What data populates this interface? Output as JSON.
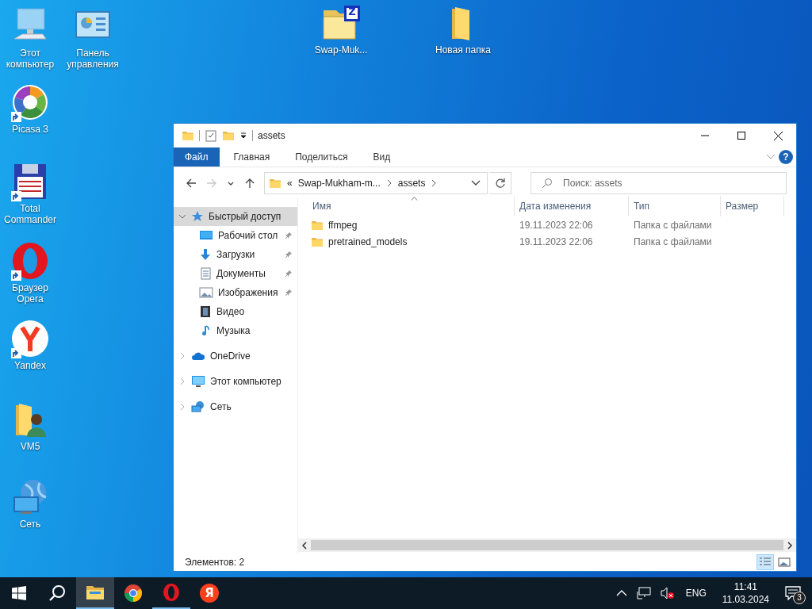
{
  "desktop_icons": [
    {
      "label": "Этот компьютер",
      "kind": "computer",
      "shortcut": false
    },
    {
      "label": "Панель управления",
      "kind": "control-panel",
      "shortcut": false
    },
    {
      "label": "Picasa 3",
      "kind": "picasa",
      "shortcut": true
    },
    {
      "label": "Total Commander",
      "kind": "total-commander",
      "shortcut": true
    },
    {
      "label": "Браузер Opera",
      "kind": "opera",
      "shortcut": true
    },
    {
      "label": "Yandex",
      "kind": "yandex",
      "shortcut": true
    },
    {
      "label": "VM5",
      "kind": "user-folder",
      "shortcut": false
    },
    {
      "label": "Сеть",
      "kind": "network",
      "shortcut": false
    },
    {
      "label": "Swap-Muk...",
      "kind": "zip-folder",
      "logo_letter": "Z",
      "shortcut": false
    },
    {
      "label": "Новая папка",
      "kind": "folder",
      "shortcut": false
    }
  ],
  "window": {
    "title": "assets",
    "ribbon_tabs": [
      {
        "label": "Файл",
        "selected": true
      },
      {
        "label": "Главная",
        "selected": false
      },
      {
        "label": "Поделиться",
        "selected": false
      },
      {
        "label": "Вид",
        "selected": false
      }
    ],
    "help": "?",
    "nav_buttons": [
      {
        "kind": "back",
        "disabled": false
      },
      {
        "kind": "forward",
        "disabled": true
      },
      {
        "kind": "recent",
        "disabled": false
      },
      {
        "kind": "up",
        "disabled": false
      }
    ],
    "address": {
      "overflow": "«",
      "crumbs": [
        "Swap-Mukham-m...",
        "assets"
      ]
    },
    "search": {
      "placeholder": "Поиск: assets"
    },
    "sidebar": [
      {
        "label": "Быстрый доступ",
        "kind": "quick",
        "expanded": true,
        "selected": true,
        "children": [
          {
            "label": "Рабочий стол",
            "kind": "desktop",
            "pinned": true,
            "selected": false
          },
          {
            "label": "Загрузки",
            "kind": "downloads",
            "pinned": true,
            "selected": false
          },
          {
            "label": "Документы",
            "kind": "documents",
            "pinned": true,
            "selected": false
          },
          {
            "label": "Изображения",
            "kind": "pictures",
            "pinned": true,
            "selected": false
          },
          {
            "label": "Видео",
            "kind": "video",
            "pinned": false,
            "selected": false
          },
          {
            "label": "Музыка",
            "kind": "music",
            "pinned": false,
            "selected": false
          }
        ]
      },
      {
        "label": "OneDrive",
        "kind": "onedrive",
        "expanded": false,
        "selected": false
      },
      {
        "label": "Этот компьютер",
        "kind": "computer",
        "expanded": false,
        "selected": false
      },
      {
        "label": "Сеть",
        "kind": "network",
        "expanded": false,
        "selected": false
      }
    ],
    "columns": [
      {
        "label": "Имя",
        "sorted": true
      },
      {
        "label": "Дата изменения",
        "sorted": false
      },
      {
        "label": "Тип",
        "sorted": false
      },
      {
        "label": "Размер",
        "sorted": false
      }
    ],
    "rows": [
      {
        "name": "ffmpeg",
        "date": "19.11.2023 22:06",
        "type": "Папка с файлами"
      },
      {
        "name": "pretrained_models",
        "date": "19.11.2023 22:06",
        "type": "Папка с файлами"
      }
    ],
    "status_bar": "Элементов: 2",
    "views": [
      {
        "kind": "details",
        "selected": true
      },
      {
        "kind": "large-icons",
        "selected": false
      }
    ]
  },
  "taskbar": {
    "apps": [
      {
        "kind": "explorer",
        "active": true,
        "running": true
      },
      {
        "kind": "chrome",
        "active": false,
        "running": false
      },
      {
        "kind": "opera",
        "active": false,
        "running": true
      },
      {
        "kind": "yandex",
        "logo_letter": "Я",
        "active": false,
        "running": false
      }
    ],
    "language": "ENG",
    "time": "11:41",
    "date": "11.03.2024",
    "notifications": "3"
  }
}
